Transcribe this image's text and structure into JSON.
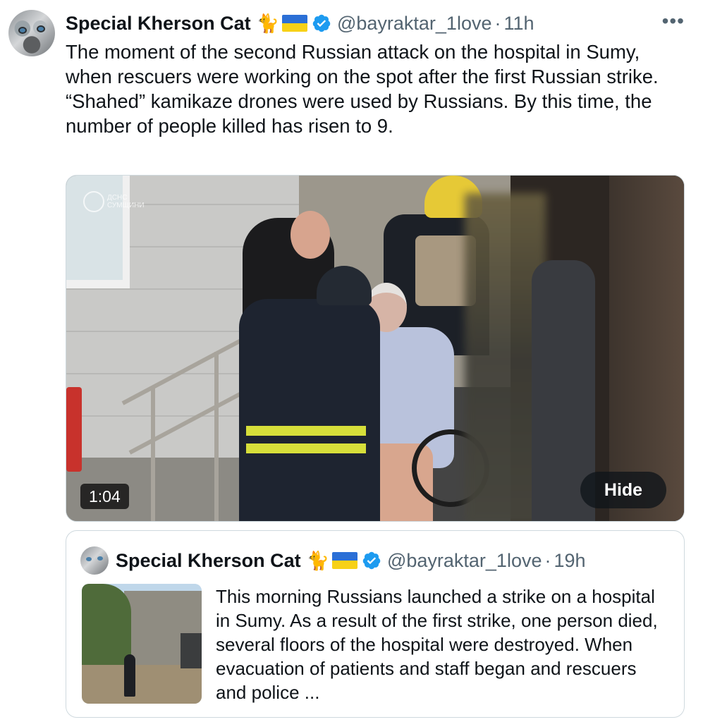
{
  "tweet": {
    "author_name": "Special Kherson Cat",
    "emoji": "🐈",
    "handle": "@bayraktar_1love",
    "separator": "·",
    "time": "11h",
    "more_label": "•••",
    "text": "The moment of the second Russian attack on the hospital in Sumy, when rescuers were working on the spot after the first Russian strike. “Shahed” kamikaze drones were used by Russians. By this time, the number of people killed has risen to 9."
  },
  "video": {
    "watermark": [
      "ДСНС",
      "СУМЩИНИ"
    ],
    "duration": "1:04",
    "hide_label": "Hide"
  },
  "quote": {
    "author_name": "Special Kherson Cat",
    "emoji": "🐈",
    "handle": "@bayraktar_1love",
    "separator": "·",
    "time": "19h",
    "text": "This morning Russians launched a strike on a hospital in Sumy. As a result of the first strike, one person died, several floors of the hospital were destroyed. When evacuation of patients and staff began and rescuers and police ..."
  },
  "colors": {
    "text_primary": "#0f1419",
    "text_secondary": "#536471",
    "verified_blue": "#1d9bf0",
    "border": "#cfd9de",
    "flag_blue": "#2b6fd6",
    "flag_yellow": "#f7d117"
  },
  "icons": [
    "avatar",
    "cat-emoji",
    "ukraine-flag-icon",
    "verified-badge-icon",
    "more-options-icon"
  ]
}
